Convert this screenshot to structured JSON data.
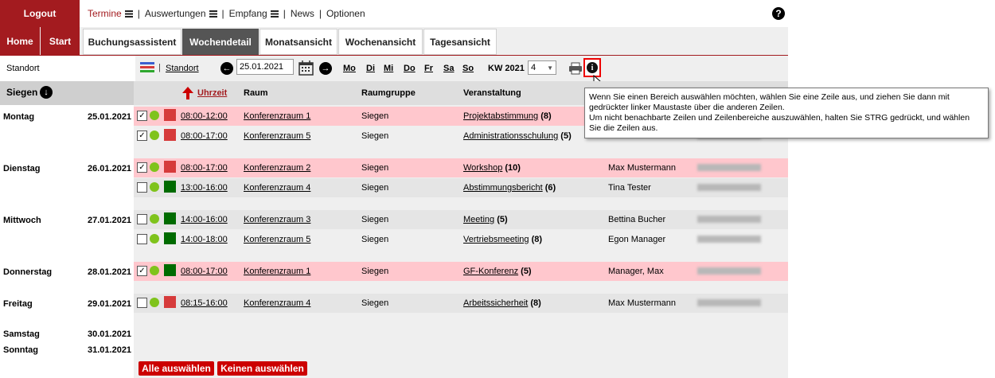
{
  "top": {
    "logout": "Logout",
    "menu": [
      {
        "label": "Termine",
        "active": true,
        "hamburger": true
      },
      {
        "label": "Auswertungen",
        "hamburger": true
      },
      {
        "label": "Empfang",
        "hamburger": true
      },
      {
        "label": "News",
        "hamburger": false
      },
      {
        "label": "Optionen",
        "hamburger": false
      }
    ]
  },
  "nav": {
    "home": "Home",
    "start": "Start",
    "tabs": [
      "Buchungsassistent",
      "Wochendetail",
      "Monatsansicht",
      "Wochenansicht",
      "Tagesansicht"
    ],
    "active_tab": "Wochendetail"
  },
  "toolbar": {
    "standort_label": "Standort",
    "standort_link": "Standort",
    "date": "25.01.2021",
    "days": [
      "Mo",
      "Di",
      "Mi",
      "Do",
      "Fr",
      "Sa",
      "So"
    ],
    "kw_label": "KW 2021",
    "kw_value": "4"
  },
  "header": {
    "location": "Siegen",
    "uhrzeit": "Uhrzeit",
    "raum": "Raum",
    "raumgruppe": "Raumgruppe",
    "veranstaltung": "Veranstaltung"
  },
  "days": [
    {
      "name": "Montag",
      "date": "25.01.2021"
    },
    {
      "name": "Dienstag",
      "date": "26.01.2021"
    },
    {
      "name": "Mittwoch",
      "date": "27.01.2021"
    },
    {
      "name": "Donnerstag",
      "date": "28.01.2021"
    },
    {
      "name": "Freitag",
      "date": "29.01.2021"
    },
    {
      "name": "Samstag",
      "date": "30.01.2021"
    },
    {
      "name": "Sonntag",
      "date": "31.01.2021"
    }
  ],
  "rows": [
    {
      "checked": true,
      "status": "red",
      "time": "08:00-12:00",
      "room": "Konferenzraum 1",
      "group": "Siegen",
      "event": "Projektabstimmung",
      "count": "(8)",
      "person": ""
    },
    {
      "checked": true,
      "status": "red",
      "time": "08:00-17:00",
      "room": "Konferenzraum 5",
      "group": "Siegen",
      "event": "Administrationsschulung",
      "count": "(5)",
      "person": ""
    },
    {
      "checked": true,
      "status": "red",
      "time": "08:00-17:00",
      "room": "Konferenzraum 2",
      "group": "Siegen",
      "event": "Workshop",
      "count": "(10)",
      "person": "Max Mustermann"
    },
    {
      "checked": false,
      "status": "green",
      "time": "13:00-16:00",
      "room": "Konferenzraum 4",
      "group": "Siegen",
      "event": "Abstimmungsbericht",
      "count": "(6)",
      "person": "Tina Tester"
    },
    {
      "checked": false,
      "status": "green",
      "time": "14:00-16:00",
      "room": "Konferenzraum 3",
      "group": "Siegen",
      "event": "Meeting",
      "count": "(5)",
      "person": "Bettina Bucher"
    },
    {
      "checked": false,
      "status": "green",
      "time": "14:00-18:00",
      "room": "Konferenzraum 5",
      "group": "Siegen",
      "event": "Vertriebsmeeting",
      "count": "(8)",
      "person": "Egon Manager"
    },
    {
      "checked": true,
      "status": "green",
      "time": "08:00-17:00",
      "room": "Konferenzraum 1",
      "group": "Siegen",
      "event": "GF-Konferenz",
      "count": "(5)",
      "person": "Manager, Max"
    },
    {
      "checked": false,
      "status": "red",
      "time": "08:15-16:00",
      "room": "Konferenzraum 4",
      "group": "Siegen",
      "event": "Arbeitssicherheit",
      "count": "(8)",
      "person": "Max Mustermann"
    }
  ],
  "footer": {
    "select_all": "Alle auswählen",
    "select_none": "Keinen auswählen"
  },
  "tooltip": {
    "text1": "Wenn Sie einen Bereich auswählen möchten, wählen Sie eine Zeile aus, und ziehen Sie dann mit gedrückter linker Maustaste über die anderen Zeilen.",
    "text2": "Um nicht benachbarte Zeilen und Zeilenbereiche auszuwählen, halten Sie STRG gedrückt, und wählen Sie die Zeilen aus."
  },
  "colors": {
    "brand": "#a31b1f",
    "pink_row": "#ffc7cd",
    "red_status": "#d63b3b",
    "green_status": "#006b00",
    "dot_green": "#7fc31c"
  }
}
